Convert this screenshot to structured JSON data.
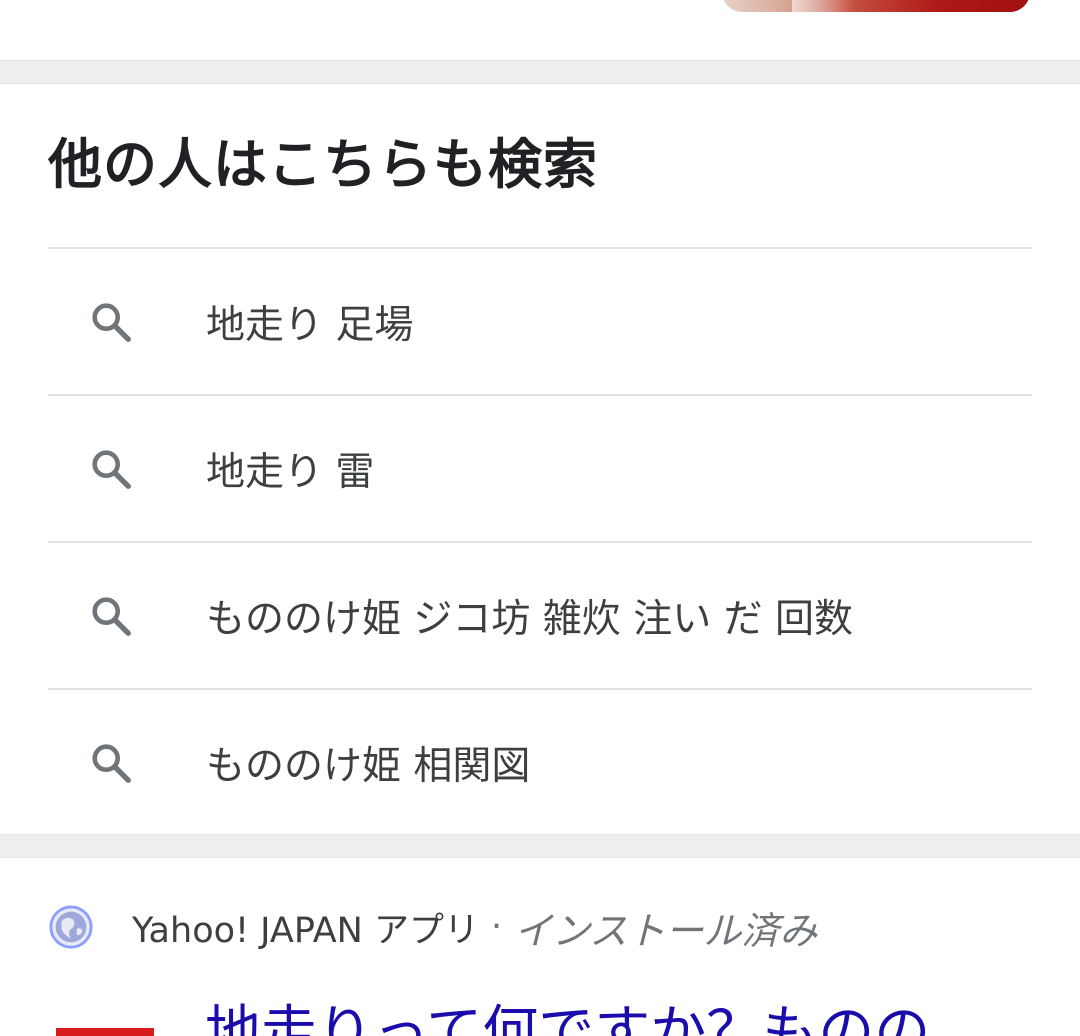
{
  "related_searches": {
    "title": "他の人はこちらも検索",
    "items": [
      {
        "label": "地走り 足場",
        "icon": "search-icon"
      },
      {
        "label": "地走り 雷",
        "icon": "search-icon"
      },
      {
        "label": "もののけ姫 ジコ坊 雑炊 注い だ 回数",
        "icon": "search-icon"
      },
      {
        "label": "もののけ姫 相関図",
        "icon": "search-icon"
      }
    ]
  },
  "result": {
    "source_icon": "globe-icon",
    "source_name": "Yahoo! JAPAN アプリ",
    "separator": "·",
    "source_status": "インストール済み",
    "title": "地走りって何ですか？ものの"
  },
  "colors": {
    "link": "#1a0dab",
    "text": "#202124",
    "divider": "#e2e2e2",
    "gap": "#eeeeee"
  }
}
